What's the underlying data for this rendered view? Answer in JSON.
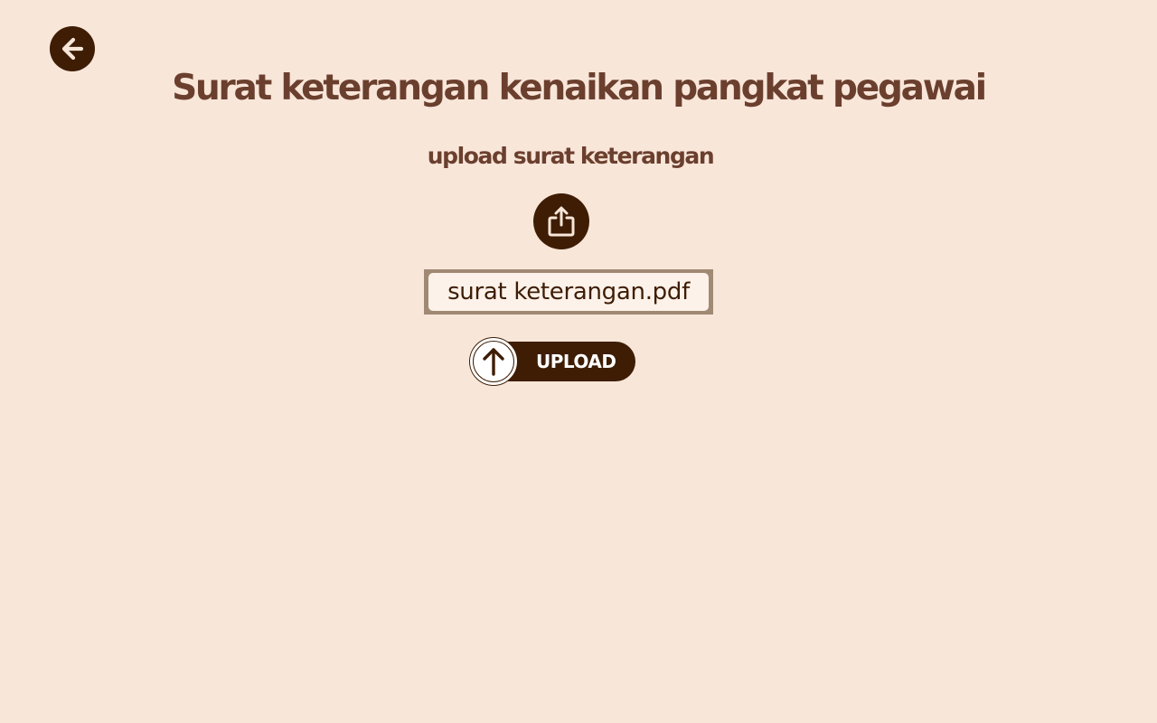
{
  "header": {
    "title": "Surat keterangan kenaikan pangkat pegawai",
    "back_icon": "arrow-left-circle-icon"
  },
  "main": {
    "subtitle": "upload surat keterangan",
    "share_icon": "share-upload-icon",
    "file_field": {
      "value": "surat keterangan.pdf"
    },
    "upload_button": {
      "label": "UPLOAD",
      "icon": "arrow-up-icon"
    }
  },
  "colors": {
    "background": "#f8e6d9",
    "primary_dark": "#3e1d04",
    "heading": "#6b3f2e",
    "field_border": "#a08a74"
  }
}
